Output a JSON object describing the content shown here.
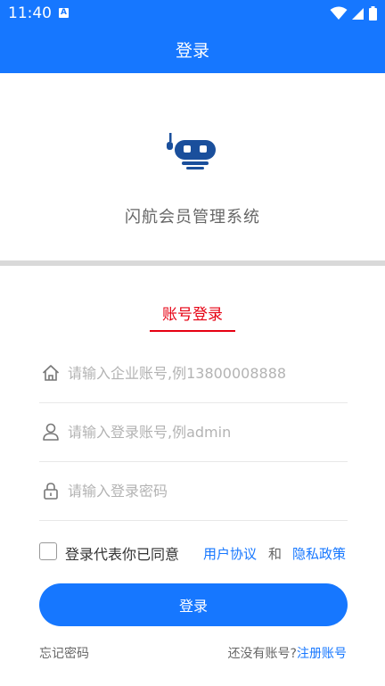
{
  "status_bar": {
    "time": "11:40",
    "notification_icon_letter": "A",
    "icons": [
      "wifi-icon",
      "signal-icon",
      "battery-icon"
    ]
  },
  "header": {
    "title": "登录",
    "color": "#1677ff"
  },
  "hero": {
    "logo_icon": "robot-logo-icon",
    "app_name": "闪航会员管理系统"
  },
  "tabs": [
    {
      "label": "账号登录",
      "active": true,
      "color": "#e60012"
    }
  ],
  "form": {
    "company": {
      "icon": "home-icon",
      "placeholder": "请输入企业账号,例13800008888",
      "value": ""
    },
    "username": {
      "icon": "user-icon",
      "placeholder": "请输入登录账号,例admin",
      "value": ""
    },
    "password": {
      "icon": "lock-icon",
      "placeholder": "请输入登录密码",
      "value": ""
    }
  },
  "agreement": {
    "checked": false,
    "text": "登录代表你已同意",
    "user_agreement": "用户协议",
    "and": "和",
    "privacy_policy": "隐私政策"
  },
  "login_button": "登录",
  "footer": {
    "forgot_password": "忘记密码",
    "no_account": "还没有账号?",
    "register": "注册账号"
  }
}
